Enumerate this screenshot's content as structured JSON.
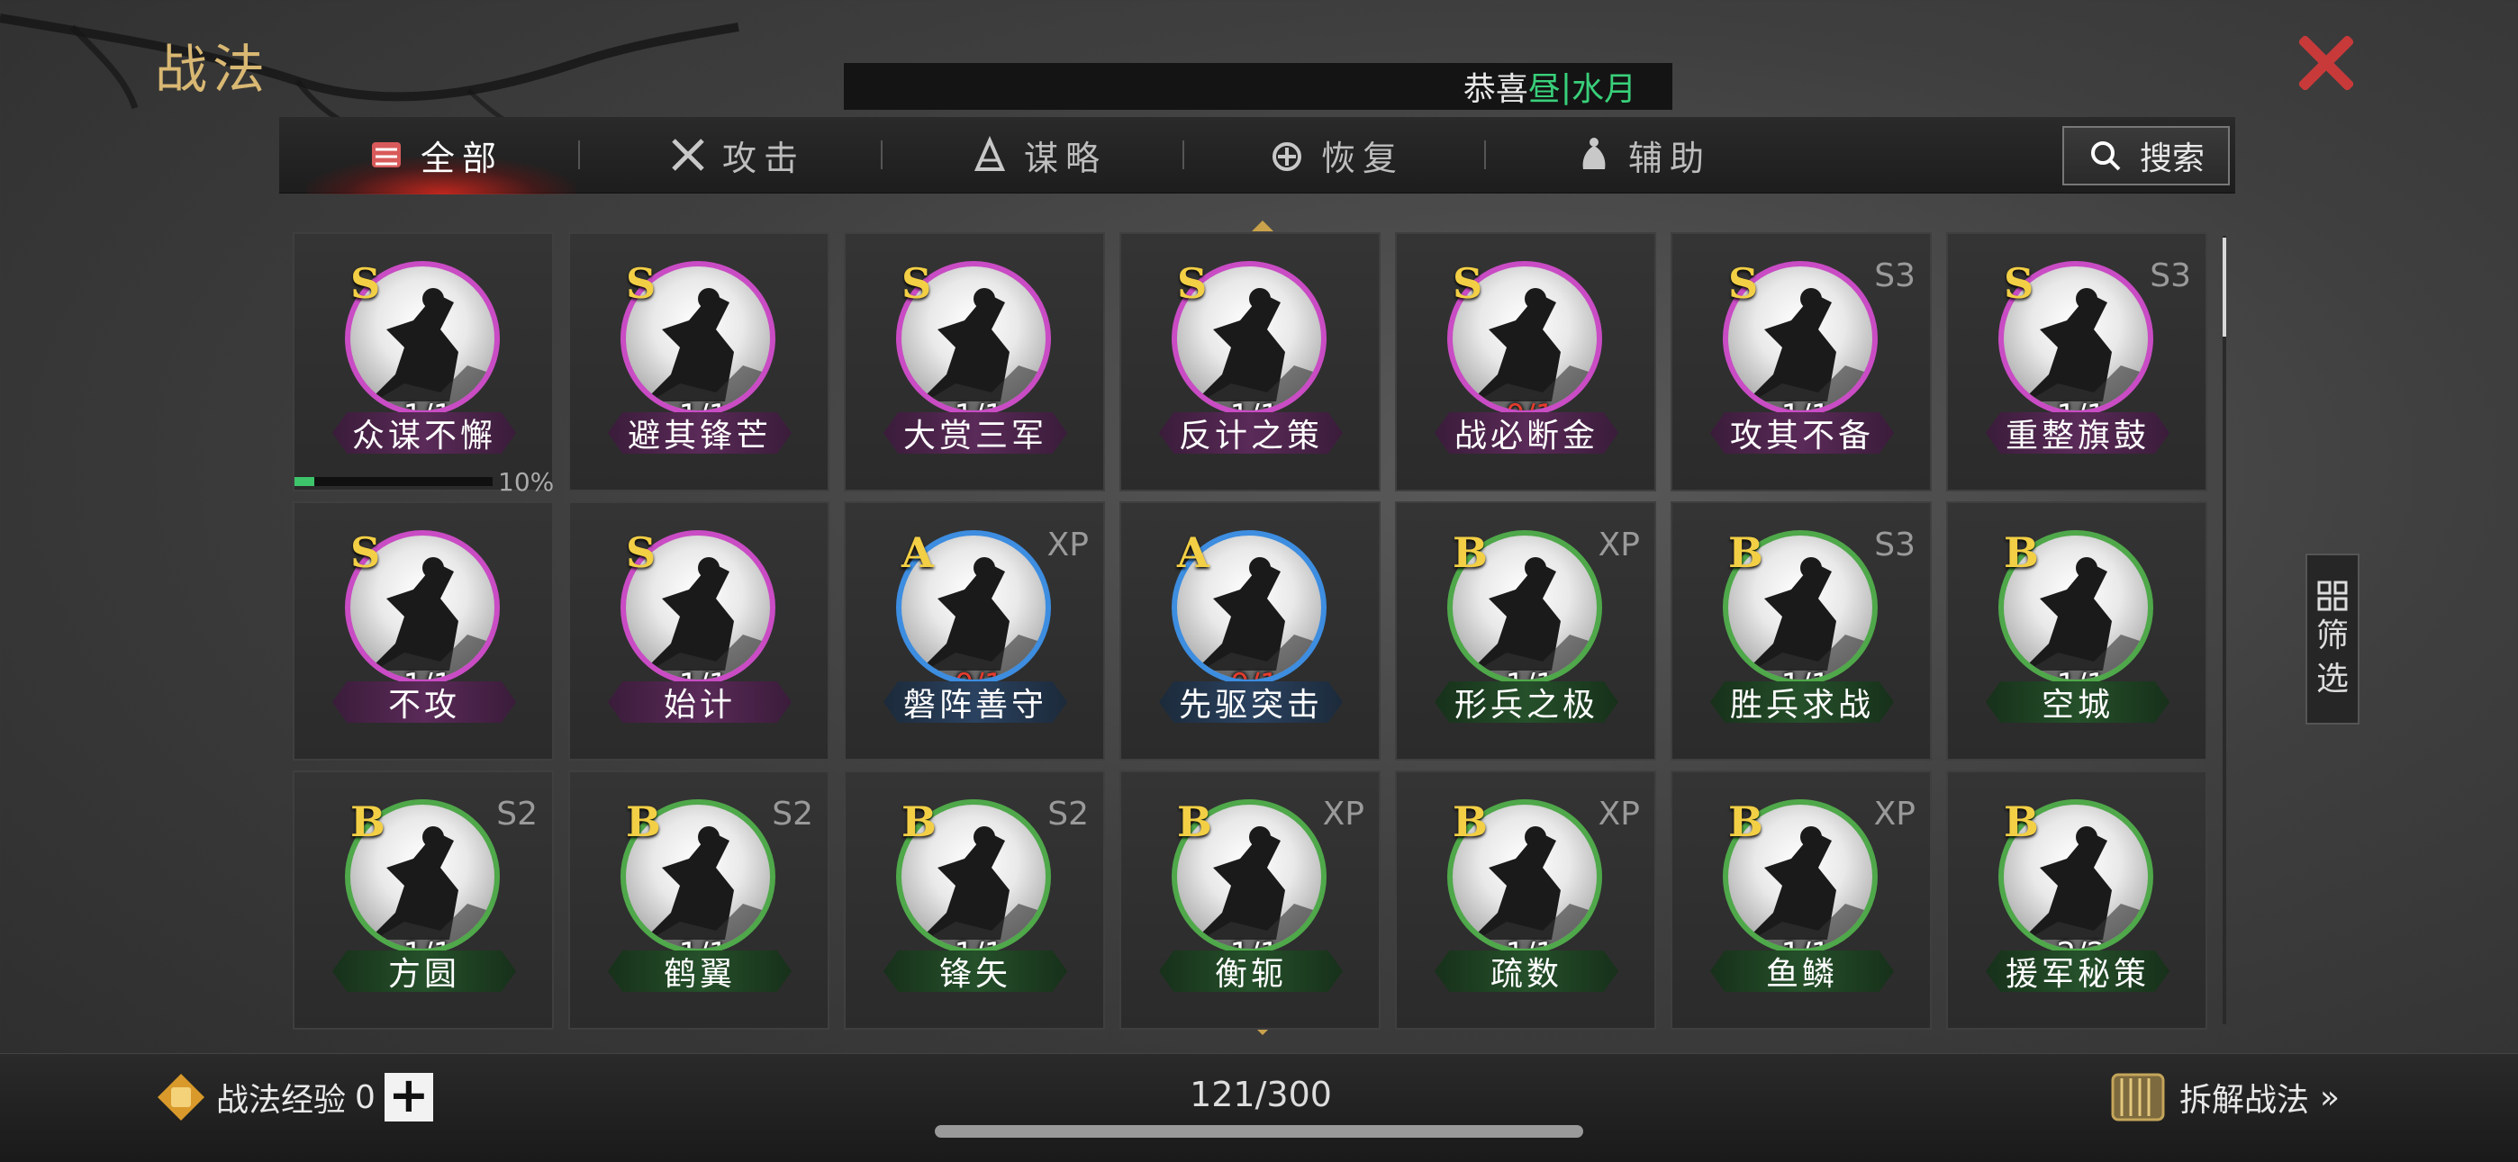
{
  "title": "战法",
  "banner": {
    "prefix": "恭喜",
    "highlight1": "昼",
    "divider": " | ",
    "highlight2": "水月"
  },
  "tabs": [
    {
      "label": "全部",
      "icon": "all-icon"
    },
    {
      "label": "攻击",
      "icon": "sword-icon"
    },
    {
      "label": "谋略",
      "icon": "strategy-icon"
    },
    {
      "label": "恢复",
      "icon": "recover-icon"
    },
    {
      "label": "辅助",
      "icon": "support-icon"
    }
  ],
  "search": {
    "label": "搜索"
  },
  "filter": {
    "label1": "筛",
    "label2": "选"
  },
  "colors": {
    "accent_gold": "#d9b873",
    "close_red": "#c83a3a",
    "banner_green": "#39d07a",
    "tier_s": "#c94cc4",
    "tier_a": "#3d8de0",
    "tier_b": "#4fa84a"
  },
  "cards": [
    {
      "grade": "S",
      "season": "",
      "count": "1/1",
      "count_red": false,
      "name": "众谋不懈",
      "tier": "purple",
      "progress": 0.1,
      "progress_label": "10%"
    },
    {
      "grade": "S",
      "season": "",
      "count": "1/1",
      "count_red": false,
      "name": "避其锋芒",
      "tier": "purple"
    },
    {
      "grade": "S",
      "season": "",
      "count": "1/1",
      "count_red": false,
      "name": "大赏三军",
      "tier": "purple"
    },
    {
      "grade": "S",
      "season": "",
      "count": "1/1",
      "count_red": false,
      "name": "反计之策",
      "tier": "purple"
    },
    {
      "grade": "S",
      "season": "",
      "count": "0/1",
      "count_red": true,
      "name": "战必断金",
      "tier": "purple"
    },
    {
      "grade": "S",
      "season": "S3",
      "count": "1/1",
      "count_red": false,
      "name": "攻其不备",
      "tier": "purple"
    },
    {
      "grade": "S",
      "season": "S3",
      "count": "1/1",
      "count_red": false,
      "name": "重整旗鼓",
      "tier": "purple"
    },
    {
      "grade": "S",
      "season": "",
      "count": "1/1",
      "count_red": false,
      "name": "不攻",
      "tier": "purple"
    },
    {
      "grade": "S",
      "season": "",
      "count": "1/1",
      "count_red": false,
      "name": "始计",
      "tier": "purple"
    },
    {
      "grade": "A",
      "season": "XP",
      "count": "0/1",
      "count_red": true,
      "name": "磐阵善守",
      "tier": "blue"
    },
    {
      "grade": "A",
      "season": "",
      "count": "0/1",
      "count_red": true,
      "name": "先驱突击",
      "tier": "blue"
    },
    {
      "grade": "B",
      "season": "XP",
      "count": "1/1",
      "count_red": false,
      "name": "形兵之极",
      "tier": "green"
    },
    {
      "grade": "B",
      "season": "S3",
      "count": "1/1",
      "count_red": false,
      "name": "胜兵求战",
      "tier": "green"
    },
    {
      "grade": "B",
      "season": "",
      "count": "1/1",
      "count_red": false,
      "name": "空城",
      "tier": "green"
    },
    {
      "grade": "B",
      "season": "S2",
      "count": "1/1",
      "count_red": false,
      "name": "方圆",
      "tier": "green"
    },
    {
      "grade": "B",
      "season": "S2",
      "count": "1/1",
      "count_red": false,
      "name": "鹤翼",
      "tier": "green"
    },
    {
      "grade": "B",
      "season": "S2",
      "count": "1/1",
      "count_red": false,
      "name": "锋矢",
      "tier": "green"
    },
    {
      "grade": "B",
      "season": "XP",
      "count": "1/1",
      "count_red": false,
      "name": "衡轭",
      "tier": "green"
    },
    {
      "grade": "B",
      "season": "XP",
      "count": "1/1",
      "count_red": false,
      "name": "疏数",
      "tier": "green"
    },
    {
      "grade": "B",
      "season": "XP",
      "count": "1/1",
      "count_red": false,
      "name": "鱼鳞",
      "tier": "green"
    },
    {
      "grade": "B",
      "season": "",
      "count": "2/2",
      "count_red": false,
      "name": "援军秘策",
      "tier": "green"
    }
  ],
  "footer": {
    "exp_label": "战法经验",
    "exp_value": "0",
    "plus_label": "+",
    "counter": "121/300",
    "dismantle_label": "拆解战法",
    "dismantle_arrow": "»"
  }
}
